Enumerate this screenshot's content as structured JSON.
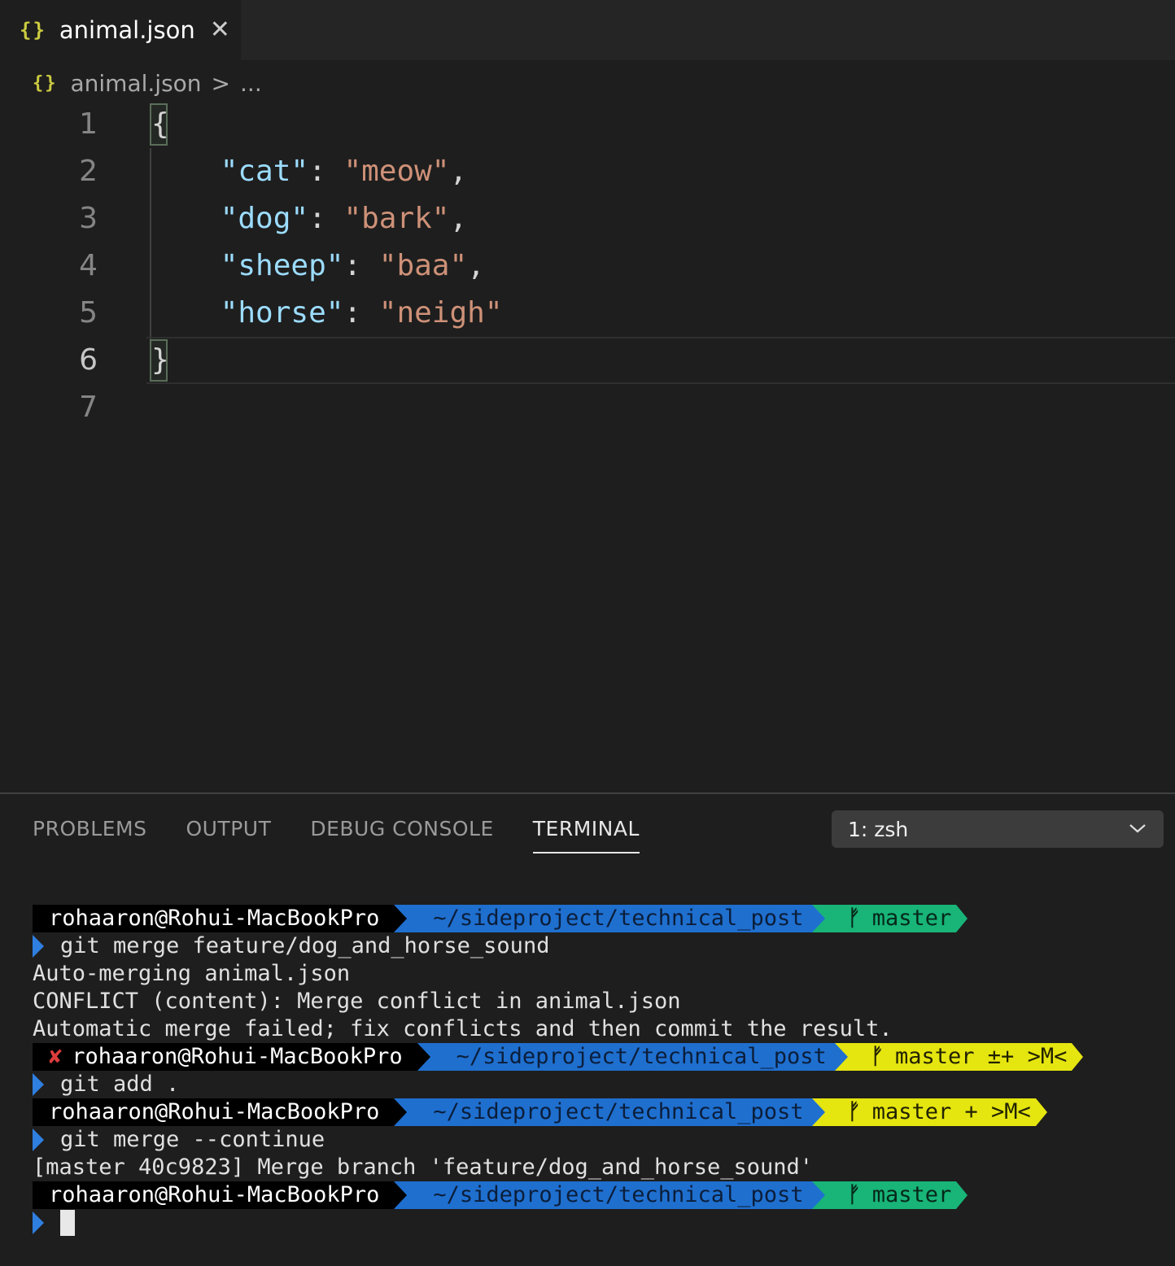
{
  "tab": {
    "icon": "{}",
    "title": "animal.json",
    "close": "✕"
  },
  "breadcrumb": {
    "icon": "{}",
    "file": "animal.json",
    "separator": ">",
    "more": "..."
  },
  "editor": {
    "line_numbers": [
      "1",
      "2",
      "3",
      "4",
      "5",
      "6",
      "7"
    ],
    "active_line": "6",
    "lines": [
      {
        "open": "{"
      },
      {
        "key": "\"cat\"",
        "colon": ": ",
        "value": "\"meow\"",
        "comma": ","
      },
      {
        "key": "\"dog\"",
        "colon": ": ",
        "value": "\"bark\"",
        "comma": ","
      },
      {
        "key": "\"sheep\"",
        "colon": ": ",
        "value": "\"baa\"",
        "comma": ","
      },
      {
        "key": "\"horse\"",
        "colon": ": ",
        "value": "\"neigh\"",
        "comma": ""
      },
      {
        "close": "}"
      }
    ],
    "colors": {
      "key": "#9cdcfe",
      "string": "#ce9178",
      "punctuation": "#d4d4d4"
    }
  },
  "panel": {
    "tabs": [
      {
        "label": "PROBLEMS"
      },
      {
        "label": "OUTPUT"
      },
      {
        "label": "DEBUG CONSOLE"
      },
      {
        "label": "TERMINAL"
      }
    ],
    "active_tab": "TERMINAL",
    "shell_select": {
      "value": "1: zsh"
    }
  },
  "terminal": {
    "user": "rohaaron@Rohui-MacBookPro",
    "dir": "~/sideproject/technical_post",
    "branch_glyph": "ᚠ",
    "prompt1": {
      "branch": "master"
    },
    "cmd1": "git merge feature/dog_and_horse_sound",
    "out1": "Auto-merging animal.json",
    "out2": "CONFLICT (content): Merge conflict in animal.json",
    "out3": "Automatic merge failed; fix conflicts and then commit the result.",
    "prompt2": {
      "error_mark": "✘",
      "branch": "master ±+ >M<"
    },
    "cmd2": "git add .",
    "prompt3": {
      "branch": "master + >M<"
    },
    "cmd3": "git merge --continue",
    "out4": "[master 40c9823] Merge branch 'feature/dog_and_horse_sound'",
    "prompt4": {
      "branch": "master"
    },
    "colors": {
      "user_bg": "#000000",
      "dir_bg": "#1f6fcf",
      "git_clean_bg": "#18b478",
      "git_dirty_bg": "#e5e510",
      "error": "#e03c3c"
    }
  }
}
